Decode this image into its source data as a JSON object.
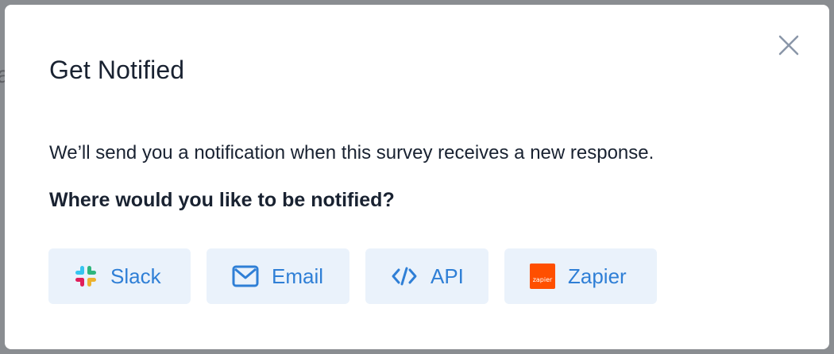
{
  "backdrop": {
    "peek_glyph": "a"
  },
  "modal": {
    "title": "Get Notified",
    "description": "We’ll send you a notification when this survey receives a new response.",
    "question": "Where would you like to be notified?",
    "close_icon": "close-icon"
  },
  "options": [
    {
      "label": "Slack",
      "icon": "slack-icon"
    },
    {
      "label": "Email",
      "icon": "email-icon"
    },
    {
      "label": "API",
      "icon": "code-icon"
    },
    {
      "label": "Zapier",
      "icon": "zapier-icon",
      "icon_text": "zapier"
    }
  ],
  "colors": {
    "accent": "#2f7fd6",
    "option_bg": "#eaf2fb",
    "text": "#192231",
    "zapier": "#ff4f00"
  }
}
